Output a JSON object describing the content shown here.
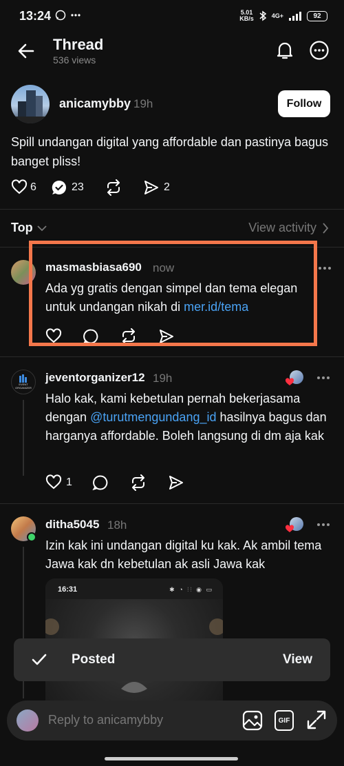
{
  "status_bar": {
    "time": "13:24",
    "speed_value": "5.01",
    "speed_unit": "KB/s",
    "network": "4G+",
    "battery": "92"
  },
  "header": {
    "title": "Thread",
    "views": "536 views"
  },
  "original_post": {
    "username": "anicamybby",
    "time": "19h",
    "follow_label": "Follow",
    "text": "Spill undangan digital yang affordable dan pastinya bagus banget pliss!",
    "likes": "6",
    "replies": "23",
    "shares": "2"
  },
  "sort": {
    "label": "Top",
    "view_activity": "View activity"
  },
  "replies": [
    {
      "username": "masmasbiasa690",
      "time": "now",
      "text_before": "Ada yg gratis dengan simpel dan tema elegan untuk undangan nikah di ",
      "link": "mer.id/tema",
      "text_after": ""
    },
    {
      "username": "jeventorganizer12",
      "time": "19h",
      "avatar_text": "EVENT ORGANIZER",
      "text_before": "Halo kak, kami kebetulan pernah bekerjasama dengan ",
      "link": "@turutmengundang_id",
      "text_after": " hasilnya bagus dan harganya affordable. Boleh langsung di dm aja kak",
      "likes": "1"
    },
    {
      "username": "ditha5045",
      "time": "18h",
      "text": "Izin kak ini undangan digital ku kak. Ak ambil tema Jawa kak dn kebetulan ak asli Jawa kak",
      "image_status_time": "16:31"
    }
  ],
  "toast": {
    "text": "Posted",
    "action": "View"
  },
  "reply_bar": {
    "placeholder": "Reply to anicamybby",
    "gif_label": "GIF"
  },
  "colors": {
    "background": "#101010",
    "link": "#4aa3f5",
    "highlight": "#f4774b",
    "muted": "#777777"
  }
}
